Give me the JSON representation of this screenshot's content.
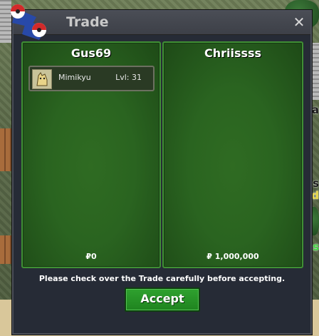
{
  "window": {
    "title": "Trade",
    "close_glyph": "✕",
    "logo_icon": "pokeball-logo-icon"
  },
  "trade": {
    "left_player": {
      "name": "Gus69",
      "items": [
        {
          "name": "Mimikyu",
          "level": "Lvl: 31",
          "icon": "mimikyu-sprite-icon"
        }
      ],
      "money": "₽0"
    },
    "right_player": {
      "name": "Chriissss",
      "items": [],
      "money": "₽ 1,000,000"
    },
    "notice": "Please check over the Trade carefully before accepting.",
    "accept_label": "Accept"
  },
  "background": {
    "edge_texts": [
      "pa",
      "s",
      "ld",
      "ss"
    ]
  },
  "colors": {
    "panel_green": "#2a6420",
    "panel_border": "#3f8f34",
    "accept_green": "#1f841f",
    "window_bg": "#262b36"
  }
}
